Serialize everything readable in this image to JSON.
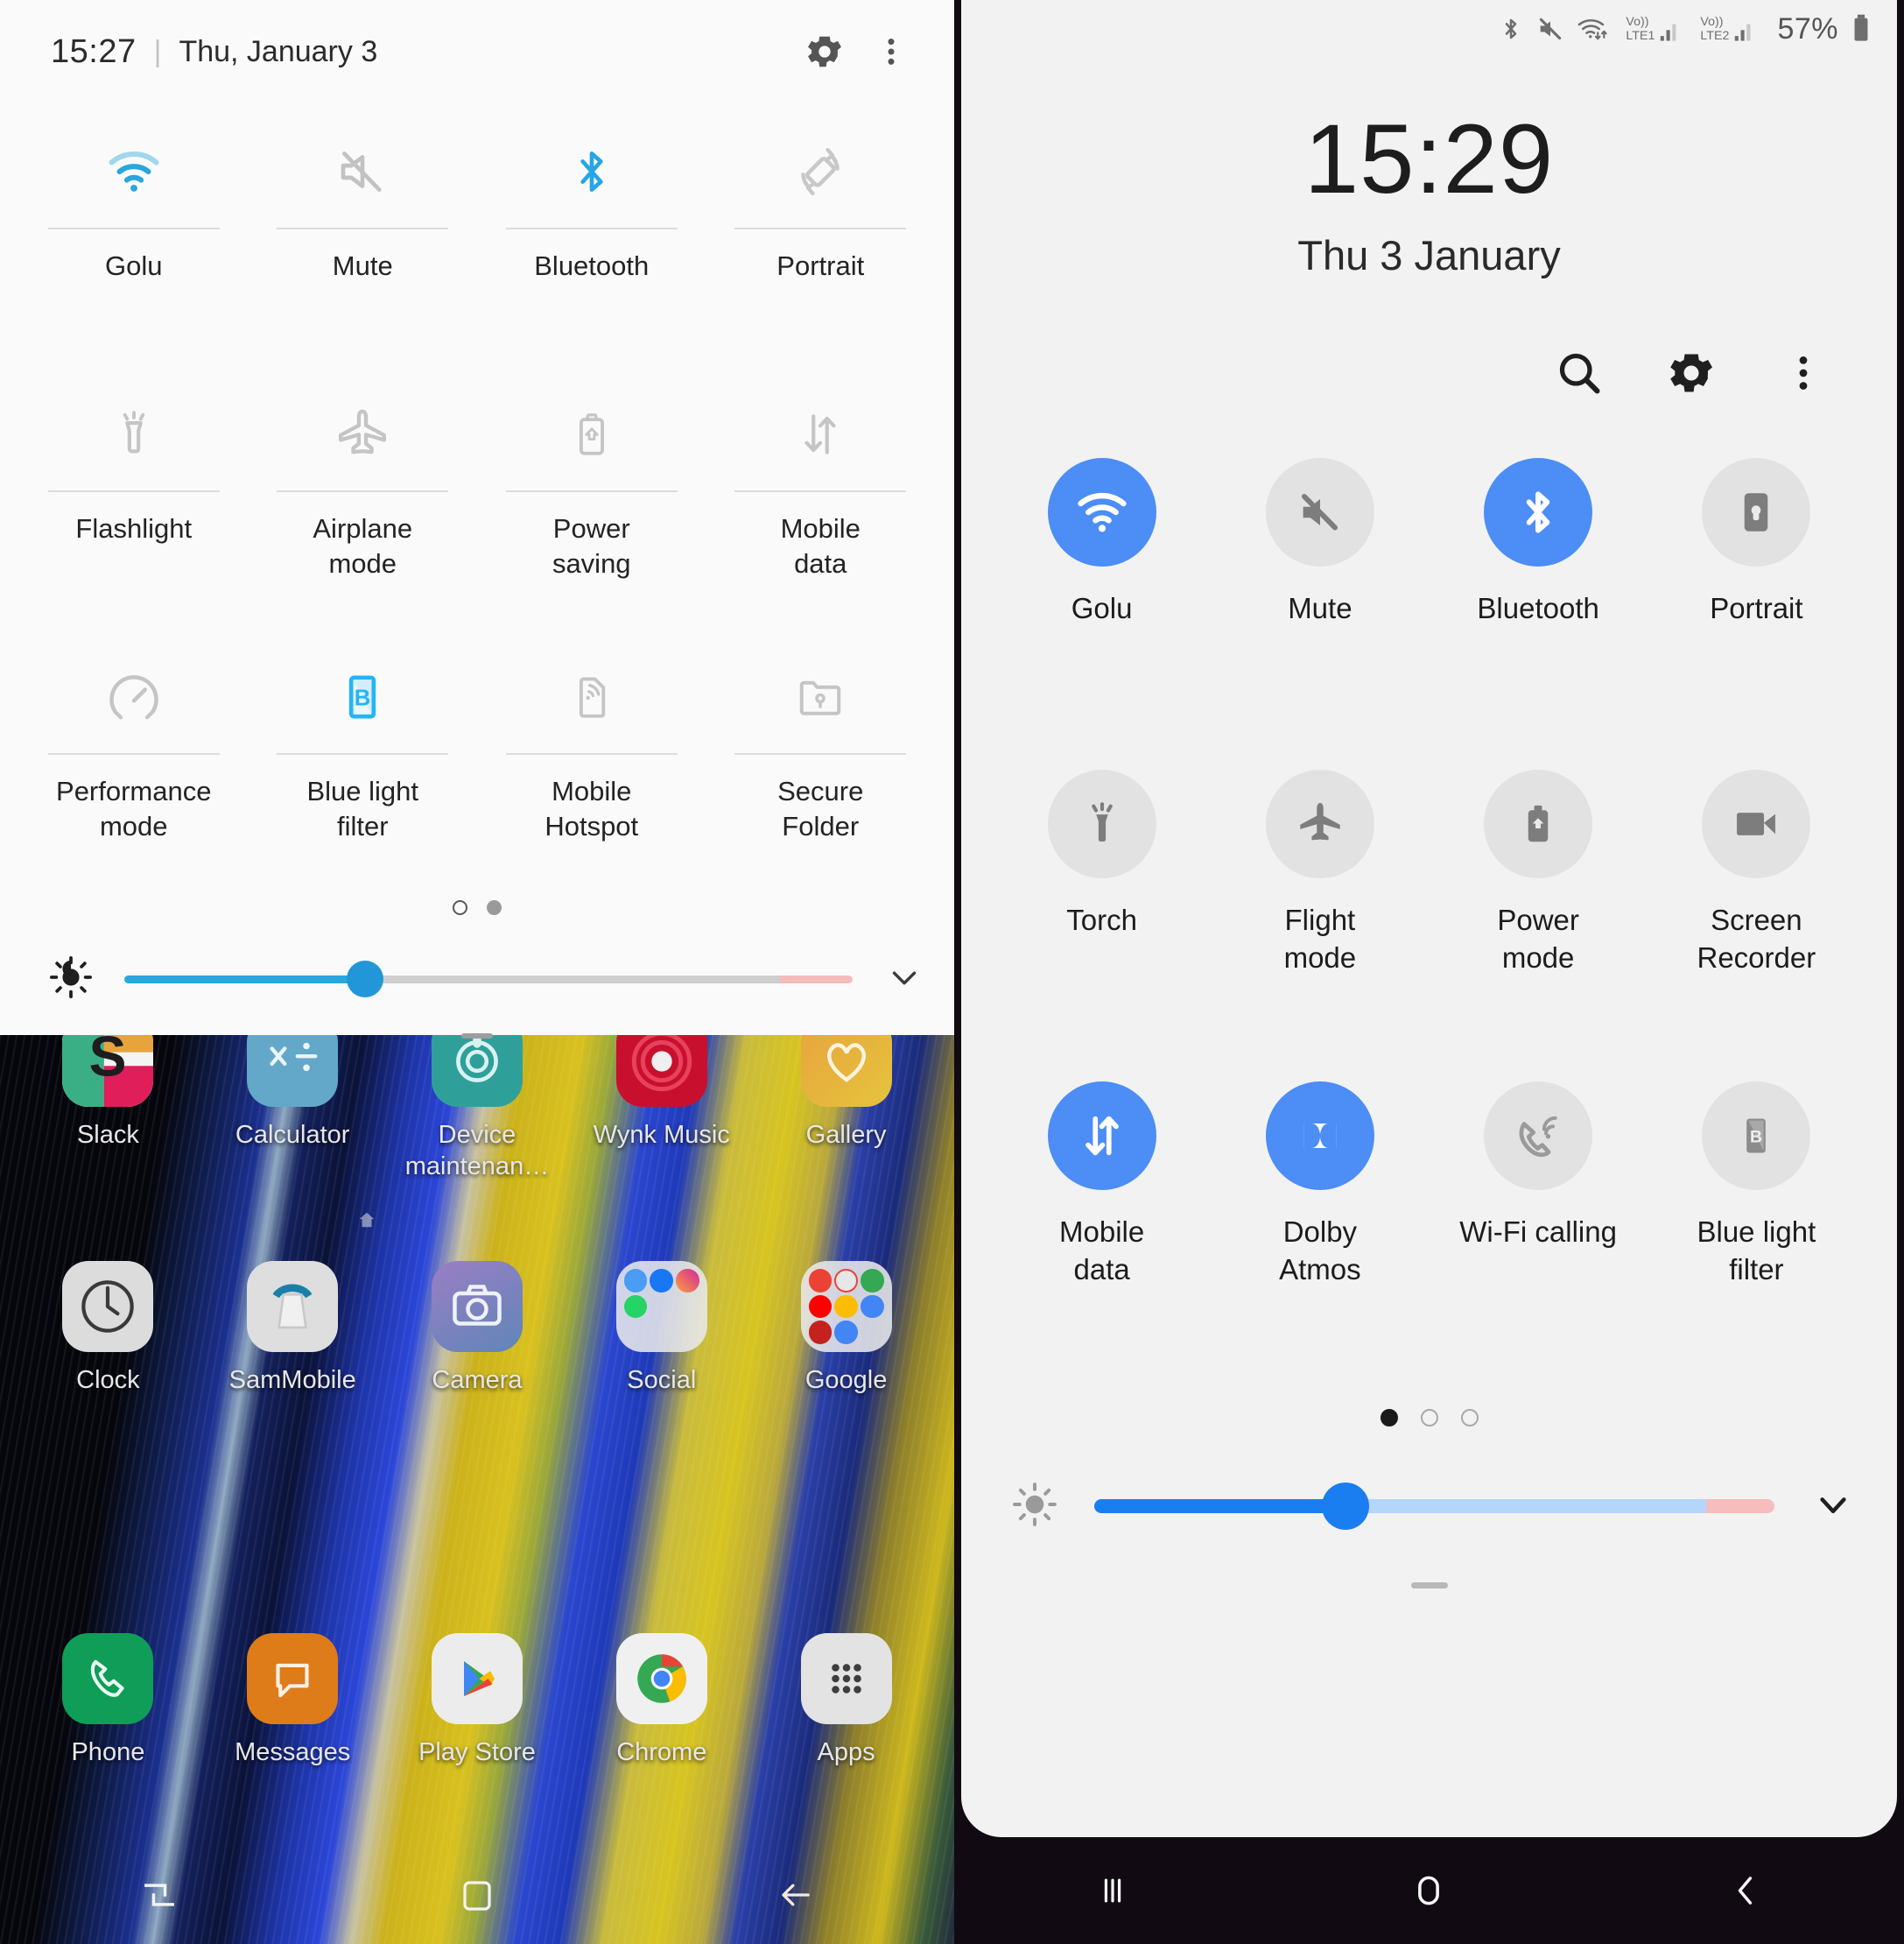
{
  "left_panel": {
    "name": "legacy-quick-settings",
    "header": {
      "clock": "15:27",
      "separator": "|",
      "date": "Thu, January 3",
      "settings_icon": "gear-icon",
      "menu_icon": "more-vertical-icon"
    },
    "tiles": [
      {
        "label": "Golu",
        "icon": "wifi-icon",
        "active": true
      },
      {
        "label": "Mute",
        "icon": "volume-mute-icon",
        "active": false
      },
      {
        "label": "Bluetooth",
        "icon": "bluetooth-icon",
        "active": true
      },
      {
        "label": "Portrait",
        "icon": "rotation-lock-icon",
        "active": false
      },
      {
        "label": "Flashlight",
        "icon": "flashlight-icon",
        "active": false
      },
      {
        "label": "Airplane\nmode",
        "icon": "airplane-icon",
        "active": false
      },
      {
        "label": "Power\nsaving",
        "icon": "battery-saver-icon",
        "active": false
      },
      {
        "label": "Mobile\ndata",
        "icon": "data-transfer-icon",
        "active": false
      },
      {
        "label": "Performance\nmode",
        "icon": "speedometer-icon",
        "active": false
      },
      {
        "label": "Blue light\nfilter",
        "icon": "blue-light-icon",
        "active": true
      },
      {
        "label": "Mobile\nHotspot",
        "icon": "hotspot-icon",
        "active": false
      },
      {
        "label": "Secure\nFolder",
        "icon": "secure-folder-icon",
        "active": false
      }
    ],
    "page_dots": {
      "count": 2,
      "active_index": 1
    },
    "brightness": {
      "icon": "brightness-icon",
      "value_percent": 33,
      "expand_icon": "chevron-down-icon"
    },
    "drag_handle": "panel-drag-handle"
  },
  "home_screen": {
    "app_rows": [
      [
        {
          "label": "Slack",
          "icon": "slack-icon"
        },
        {
          "label": "Calculator",
          "icon": "calculator-icon"
        },
        {
          "label": "Device maintenan…",
          "icon": "device-maintenance-icon"
        },
        {
          "label": "Wynk Music",
          "icon": "wynk-music-icon"
        },
        {
          "label": "Gallery",
          "icon": "gallery-icon"
        }
      ],
      [
        {
          "label": "Clock",
          "icon": "clock-icon"
        },
        {
          "label": "SamMobile",
          "icon": "sammobile-icon"
        },
        {
          "label": "Camera",
          "icon": "camera-icon"
        },
        {
          "label": "Social",
          "icon": "folder-icon"
        },
        {
          "label": "Google",
          "icon": "folder-icon"
        }
      ]
    ],
    "dock": [
      {
        "label": "Phone",
        "icon": "phone-icon"
      },
      {
        "label": "Messages",
        "icon": "messages-icon"
      },
      {
        "label": "Play Store",
        "icon": "play-store-icon"
      },
      {
        "label": "Chrome",
        "icon": "chrome-icon"
      },
      {
        "label": "Apps",
        "icon": "apps-grid-icon"
      }
    ],
    "nav_bar": [
      {
        "name": "recents-button",
        "icon": "recents-legacy-icon"
      },
      {
        "name": "home-button",
        "icon": "home-square-icon"
      },
      {
        "name": "back-button",
        "icon": "back-arrow-icon"
      }
    ]
  },
  "right_panel": {
    "name": "oneui-quick-settings",
    "status_bar": {
      "icons": [
        "bluetooth-icon",
        "mute-icon",
        "wifi-icon"
      ],
      "sim1_label": "Vo)) LTE1",
      "sim2_label": "Vo)) LTE2",
      "battery_percent": "57%",
      "battery_icon": "battery-icon"
    },
    "clock": "15:29",
    "date": "Thu 3 January",
    "actions": [
      {
        "name": "search-button",
        "icon": "search-icon"
      },
      {
        "name": "settings-button",
        "icon": "gear-icon"
      },
      {
        "name": "menu-button",
        "icon": "more-vertical-icon"
      }
    ],
    "tiles": [
      {
        "label": "Golu",
        "icon": "wifi-icon",
        "active": true
      },
      {
        "label": "Mute",
        "icon": "volume-mute-icon",
        "active": false
      },
      {
        "label": "Bluetooth",
        "icon": "bluetooth-icon",
        "active": true
      },
      {
        "label": "Portrait",
        "icon": "rotation-lock-icon",
        "active": false
      },
      {
        "label": "Torch",
        "icon": "flashlight-icon",
        "active": false
      },
      {
        "label": "Flight\nmode",
        "icon": "airplane-icon",
        "active": false
      },
      {
        "label": "Power\nmode",
        "icon": "battery-saver-icon",
        "active": false
      },
      {
        "label": "Screen\nRecorder",
        "icon": "video-camera-icon",
        "active": false
      },
      {
        "label": "Mobile\ndata",
        "icon": "data-transfer-icon",
        "active": true
      },
      {
        "label": "Dolby\nAtmos",
        "icon": "dolby-icon",
        "active": true
      },
      {
        "label": "Wi-Fi calling",
        "icon": "wifi-calling-icon",
        "active": false
      },
      {
        "label": "Blue light\nfilter",
        "icon": "blue-light-icon",
        "active": false
      }
    ],
    "page_dots": {
      "count": 3,
      "active_index": 0
    },
    "brightness": {
      "icon": "brightness-icon",
      "value_percent": 37,
      "expand_icon": "chevron-down-icon"
    },
    "drag_handle": "panel-drag-handle",
    "nav_bar": [
      {
        "name": "recents-button",
        "icon": "recents-bars-icon"
      },
      {
        "name": "home-button",
        "icon": "home-circle-icon"
      },
      {
        "name": "back-button",
        "icon": "back-chevron-icon"
      }
    ]
  },
  "colors": {
    "accent_blue": "#4c8df6",
    "legacy_blue": "#29a8dd",
    "tile_off_bg": "#e2e2e2",
    "panel_bg": "#f2f2f2",
    "legacy_panel_bg": "#fafafa"
  }
}
